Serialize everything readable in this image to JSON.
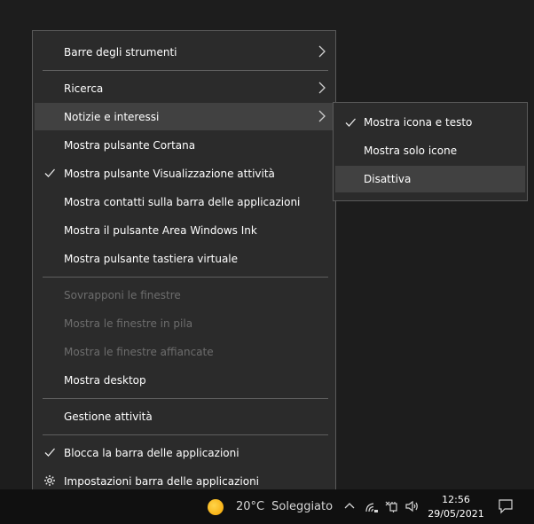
{
  "menu": {
    "items": [
      {
        "label": "Barre degli strumenti"
      },
      {
        "label": "Ricerca"
      },
      {
        "label": "Notizie e interessi"
      },
      {
        "label": "Mostra pulsante Cortana"
      },
      {
        "label": "Mostra pulsante Visualizzazione attività"
      },
      {
        "label": "Mostra contatti sulla barra delle applicazioni"
      },
      {
        "label": "Mostra il pulsante Area Windows Ink"
      },
      {
        "label": "Mostra pulsante tastiera virtuale"
      },
      {
        "label": "Sovrapponi le finestre"
      },
      {
        "label": "Mostra le finestre in pila"
      },
      {
        "label": "Mostra le finestre affiancate"
      },
      {
        "label": "Mostra desktop"
      },
      {
        "label": "Gestione attività"
      },
      {
        "label": "Blocca la barra delle applicazioni"
      },
      {
        "label": "Impostazioni barra delle applicazioni"
      }
    ]
  },
  "submenu": {
    "items": [
      {
        "label": "Mostra icona e testo"
      },
      {
        "label": "Mostra solo icone"
      },
      {
        "label": "Disattiva"
      }
    ]
  },
  "taskbar": {
    "weather_temp": "20°C",
    "weather_condition": "Soleggiato",
    "time": "12:56",
    "date": "29/05/2021"
  },
  "icons": {
    "check": "checkmark-icon",
    "arrow": "chevron-right-icon",
    "settings": "gear-icon"
  },
  "colors": {
    "menu_bg": "#2b2b2b",
    "highlight": "#414141",
    "disabled_text": "#6d6d6d",
    "taskbar_bg": "#101010"
  }
}
